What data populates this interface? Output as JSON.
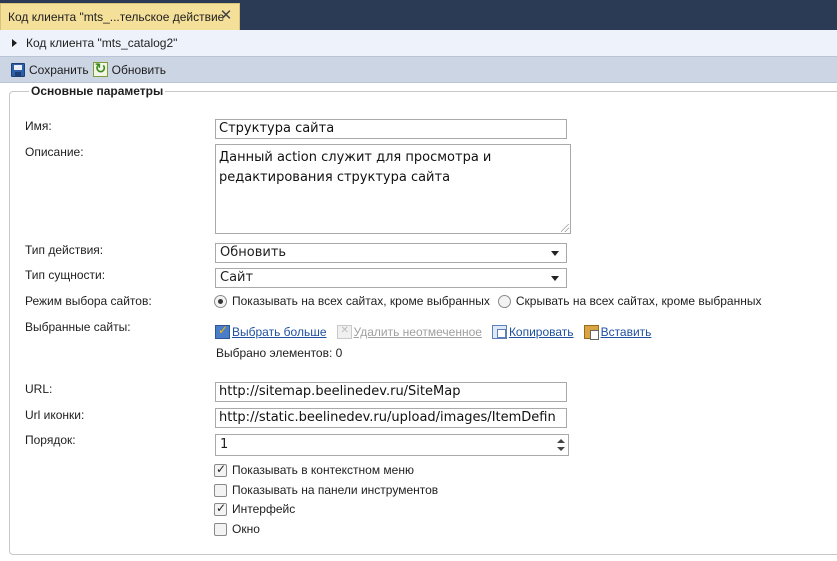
{
  "tab": {
    "title": "Код клиента \"mts_...тельское действие",
    "close_glyph": "✕"
  },
  "breadcrumb": {
    "text": "Код клиента \"mts_catalog2\""
  },
  "toolbar": {
    "save_label": "Сохранить",
    "refresh_label": "Обновить"
  },
  "section": {
    "legend": "Основные параметры"
  },
  "form": {
    "name": {
      "label": "Имя:",
      "value": "Структура сайта"
    },
    "description": {
      "label": "Описание:",
      "value": "Данный action служит для просмотра и редактирования структура сайта"
    },
    "action_type": {
      "label": "Тип действия:",
      "value": "Обновить"
    },
    "entity_type": {
      "label": "Тип сущности:",
      "value": "Сайт"
    },
    "site_mode": {
      "label": "Режим выбора сайтов:",
      "options": [
        "Показывать на всех сайтах, кроме выбранных",
        "Скрывать на всех сайтах, кроме выбранных"
      ],
      "selected_index": 0
    },
    "selected_sites": {
      "label": "Выбранные сайты:",
      "actions": [
        "Выбрать больше",
        "Удалить неотмеченное",
        "Копировать",
        "Вставить"
      ],
      "count_text": "Выбрано элементов: 0"
    },
    "url": {
      "label": "URL:",
      "value": "http://sitemap.beelinedev.ru/SiteMap"
    },
    "icon_url": {
      "label": "Url иконки:",
      "value": "http://static.beelinedev.ru/upload/images/ItemDefin"
    },
    "order": {
      "label": "Порядок:",
      "value": "1"
    },
    "checkboxes": [
      {
        "label": "Показывать в контекстном меню",
        "checked": true
      },
      {
        "label": "Показывать на панели инструментов",
        "checked": false
      },
      {
        "label": "Интерфейс",
        "checked": true
      },
      {
        "label": "Окно",
        "checked": false
      }
    ]
  }
}
